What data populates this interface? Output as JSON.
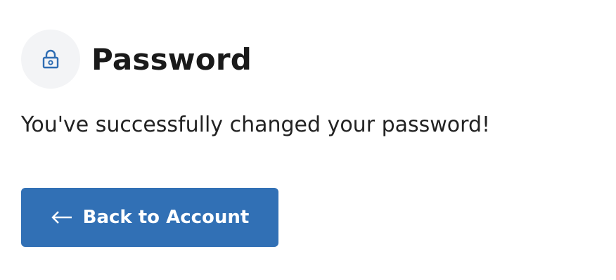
{
  "header": {
    "icon": "lock-icon",
    "title": "Password"
  },
  "message": "You've successfully changed your password!",
  "back_button": {
    "icon": "arrow-left-icon",
    "label": "Back to Account"
  },
  "colors": {
    "accent": "#3170b5",
    "icon_bg": "#f3f4f6",
    "icon_color": "#2f6db3",
    "text": "#1c1c1c"
  }
}
